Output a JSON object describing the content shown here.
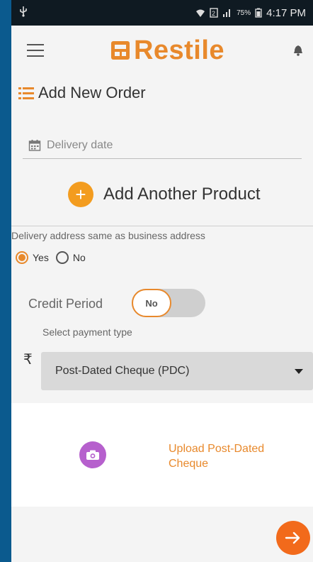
{
  "status_bar": {
    "left_icon": "usb-icon",
    "battery": "75%",
    "time": "4:17 PM"
  },
  "app_bar": {
    "brand": "Restile",
    "menu_icon": "hamburger-menu-icon",
    "notification_icon": "bell-icon"
  },
  "page": {
    "title": "Add New Order"
  },
  "form": {
    "delivery_date_placeholder": "Delivery date",
    "add_product_label": "Add Another Product",
    "address_question": "Delivery address same as business address",
    "address_options": [
      {
        "label": "Yes",
        "selected": true
      },
      {
        "label": "No",
        "selected": false
      }
    ],
    "credit_period_label": "Credit Period",
    "credit_period_toggle": "No",
    "payment_type_label": "Select payment type",
    "currency_symbol": "₹",
    "payment_type_value": "Post-Dated Cheque (PDC)",
    "upload_label": "Upload Post-Dated Cheque"
  },
  "colors": {
    "accent": "#e8892c",
    "camera": "#b660cd",
    "next": "#f26a1b",
    "frame": "#0b5a8e"
  }
}
